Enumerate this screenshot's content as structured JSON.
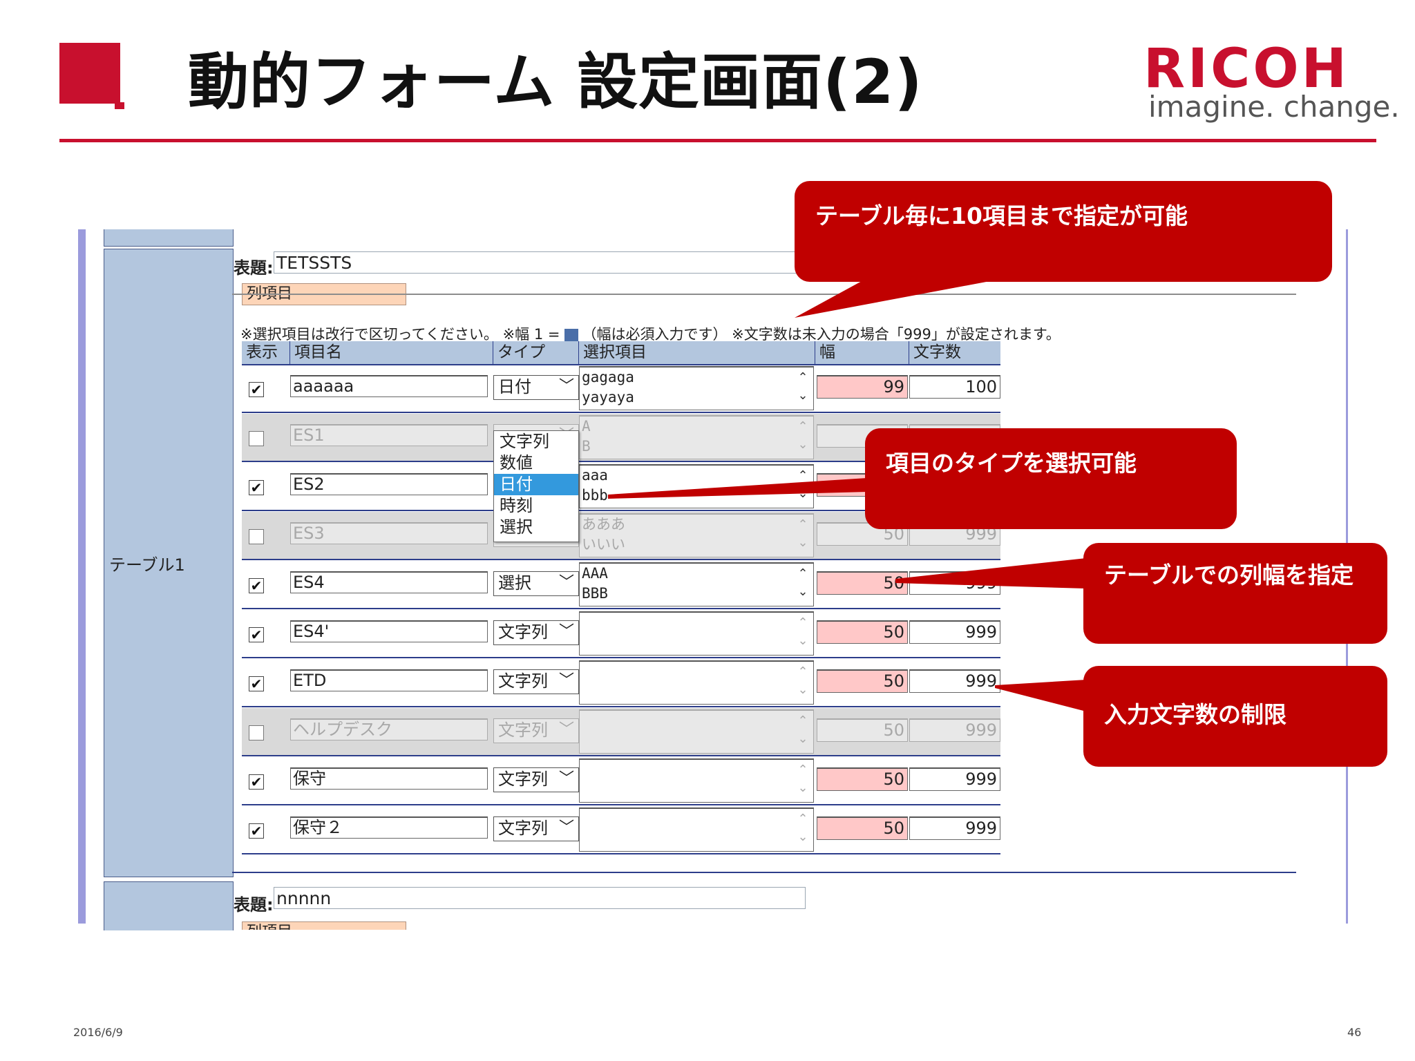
{
  "slide": {
    "title": "動的フォーム 設定画面(2)",
    "logo_word": "RICOH",
    "logo_tagline": "imagine. change.",
    "date": "2016/6/9",
    "page_number": "46"
  },
  "form": {
    "table_label": "テーブル1",
    "caption_label": "表題:",
    "caption_value": "TETSSTS",
    "section_tab": "列項目",
    "note_prefix": "※選択項目は改行で区切ってください。 ※幅 1 =",
    "note_suffix": "（幅は必須入力です） ※文字数は未入力の場合「999」が設定されます。",
    "headers": {
      "show": "表示",
      "name": "項目名",
      "type": "タイプ",
      "options": "選択項目",
      "width": "幅",
      "chars": "文字数"
    },
    "rows": [
      {
        "checked": true,
        "name": "aaaaaa",
        "type": "日付",
        "options": "gagaga\nyayaya",
        "width": "99",
        "chars": "100",
        "disabled": false
      },
      {
        "checked": false,
        "name": "ES1",
        "type": "",
        "options": "A\nB",
        "width": "",
        "chars": "",
        "disabled": true
      },
      {
        "checked": true,
        "name": "ES2",
        "type": "",
        "options": "aaa\nbbb",
        "width": "",
        "chars": "",
        "disabled": false
      },
      {
        "checked": false,
        "name": "ES3",
        "type": "",
        "options": "あああ\nいいい",
        "width": "50",
        "chars": "999",
        "disabled": true
      },
      {
        "checked": true,
        "name": "ES4",
        "type": "選択",
        "options": "AAA\nBBB",
        "width": "50",
        "chars": "999",
        "disabled": false
      },
      {
        "checked": true,
        "name": "ES4'",
        "type": "文字列",
        "options": "",
        "width": "50",
        "chars": "999",
        "disabled": false
      },
      {
        "checked": true,
        "name": "ETD",
        "type": "文字列",
        "options": "",
        "width": "50",
        "chars": "999",
        "disabled": false
      },
      {
        "checked": false,
        "name": "ヘルプデスク",
        "type": "文字列",
        "options": "",
        "width": "50",
        "chars": "999",
        "disabled": true
      },
      {
        "checked": true,
        "name": "保守",
        "type": "文字列",
        "options": "",
        "width": "50",
        "chars": "999",
        "disabled": false
      },
      {
        "checked": true,
        "name": "保守２",
        "type": "文字列",
        "options": "",
        "width": "50",
        "chars": "999",
        "disabled": false
      }
    ],
    "dropdown": {
      "options": [
        "文字列",
        "数値",
        "日付",
        "時刻",
        "選択"
      ],
      "selected": "日付"
    },
    "next_caption_label": "表題:",
    "next_caption_value": "nnnnn",
    "next_section_tab": "列項目"
  },
  "callouts": {
    "per_table_limit": "テーブル毎に10項目まで指定が可能",
    "type_select": "項目のタイプを選択可能",
    "column_width": "テーブルでの列幅を指定",
    "char_limit": "入力文字数の制限"
  },
  "colors": {
    "brand_red": "#c8102e",
    "callout_red": "#c00000",
    "label_blue": "#b3c6de",
    "width_pink": "#ffc8c8",
    "section_tab_orange": "#fdd5b8"
  }
}
